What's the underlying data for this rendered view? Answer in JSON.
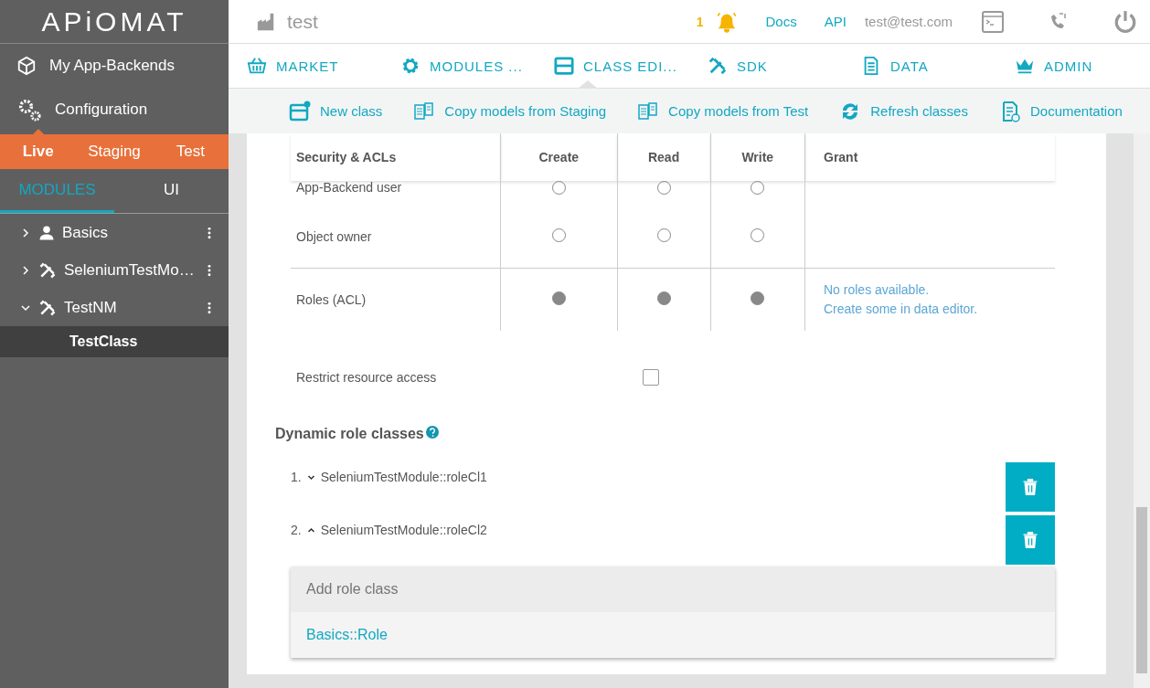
{
  "logo": "APiOMAT",
  "sidebar": {
    "items": [
      {
        "label": "My App-Backends"
      },
      {
        "label": "Configuration"
      }
    ],
    "environments": [
      {
        "label": "Live",
        "selected": true
      },
      {
        "label": "Staging",
        "selected": false
      },
      {
        "label": "Test",
        "selected": false
      }
    ],
    "tabs": [
      {
        "label": "MODULES",
        "selected": true
      },
      {
        "label": "UI",
        "selected": false
      }
    ],
    "tree": [
      {
        "label": "Basics",
        "expanded": false
      },
      {
        "label": "SeleniumTestMo…",
        "expanded": false
      },
      {
        "label": "TestNM",
        "expanded": true,
        "children": [
          {
            "label": "TestClass",
            "selected": true
          }
        ]
      }
    ]
  },
  "header": {
    "title": "test",
    "notification_count": "1",
    "links": [
      "Docs",
      "API"
    ],
    "email": "test@test.com"
  },
  "nav": [
    {
      "label": "MARKET",
      "selected": false
    },
    {
      "label": "MODULES ...",
      "selected": false
    },
    {
      "label": "CLASS EDI...",
      "selected": true
    },
    {
      "label": "SDK",
      "selected": false
    },
    {
      "label": "DATA",
      "selected": false
    },
    {
      "label": "ADMIN",
      "selected": false
    }
  ],
  "toolbar": [
    "New class",
    "Copy models from Staging",
    "Copy models from Test",
    "Refresh classes",
    "Documentation"
  ],
  "table": {
    "columns": [
      "Security & ACLs",
      "Create",
      "Read",
      "Write",
      "Grant"
    ],
    "rows": [
      {
        "label": "App-Backend user",
        "cells": [
          {
            "checked": false
          },
          {
            "checked": false
          },
          {
            "checked": false
          }
        ]
      },
      {
        "label": "Object owner",
        "cells": [
          {
            "checked": false
          },
          {
            "checked": false
          },
          {
            "checked": false
          }
        ]
      },
      {
        "label": "Roles (ACL)",
        "cells": [
          {
            "checked": true
          },
          {
            "checked": true
          },
          {
            "checked": true
          }
        ],
        "grant": [
          "No roles available.",
          "Create some in data editor."
        ]
      }
    ]
  },
  "restrict": {
    "label": "Restrict resource access",
    "checked": false
  },
  "dynamic_roles": {
    "title": "Dynamic role classes",
    "items": [
      {
        "number": "1.",
        "name": "SeleniumTestModule::roleCl1",
        "expanded": false
      },
      {
        "number": "2.",
        "name": "SeleniumTestModule::roleCl2",
        "expanded": true
      }
    ],
    "dropdown": {
      "placeholder": "Add role class",
      "options": [
        "Basics::Role"
      ]
    }
  }
}
